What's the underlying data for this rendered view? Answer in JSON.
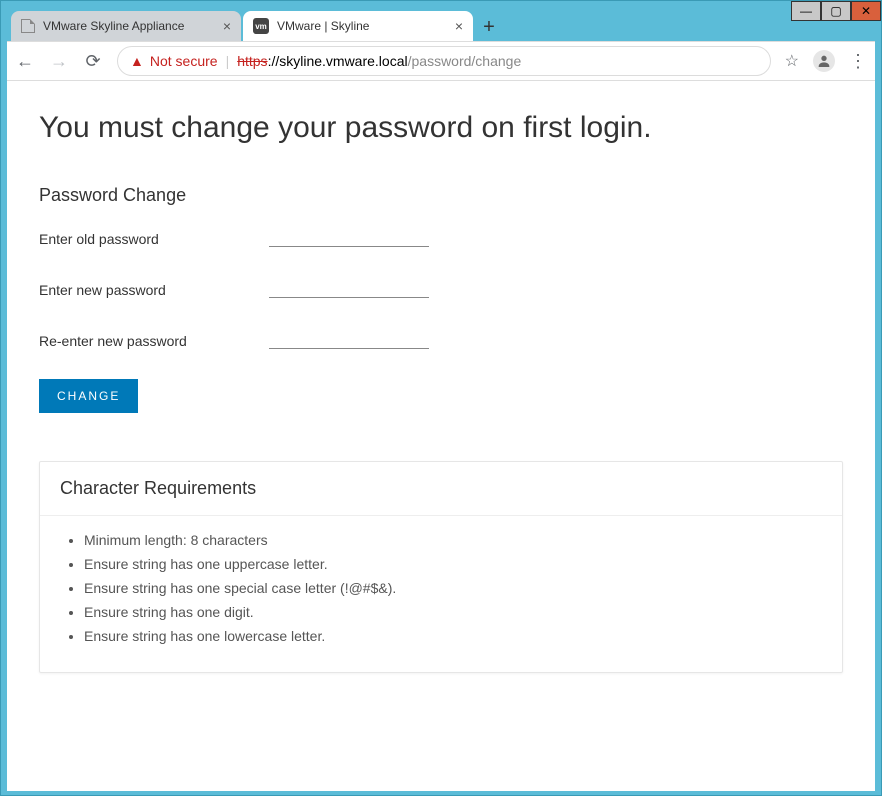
{
  "window": {
    "tabs": [
      {
        "title": "VMware Skyline Appliance",
        "active": false
      },
      {
        "title": "VMware | Skyline",
        "active": true
      }
    ]
  },
  "browser": {
    "not_secure_label": "Not secure",
    "url_scheme": "https",
    "url_host": "://skyline.vmware.local",
    "url_path": "/password/change"
  },
  "page": {
    "heading": "You must change your password on first login.",
    "section_title": "Password Change",
    "labels": {
      "old": "Enter old password",
      "new": "Enter new password",
      "re": "Re-enter new password"
    },
    "change_button": "CHANGE",
    "requirements_title": "Character Requirements",
    "requirements": [
      "Minimum length: 8 characters",
      "Ensure string has one uppercase letter.",
      "Ensure string has one special case letter (!@#$&).",
      "Ensure string has one digit.",
      "Ensure string has one lowercase letter."
    ]
  }
}
